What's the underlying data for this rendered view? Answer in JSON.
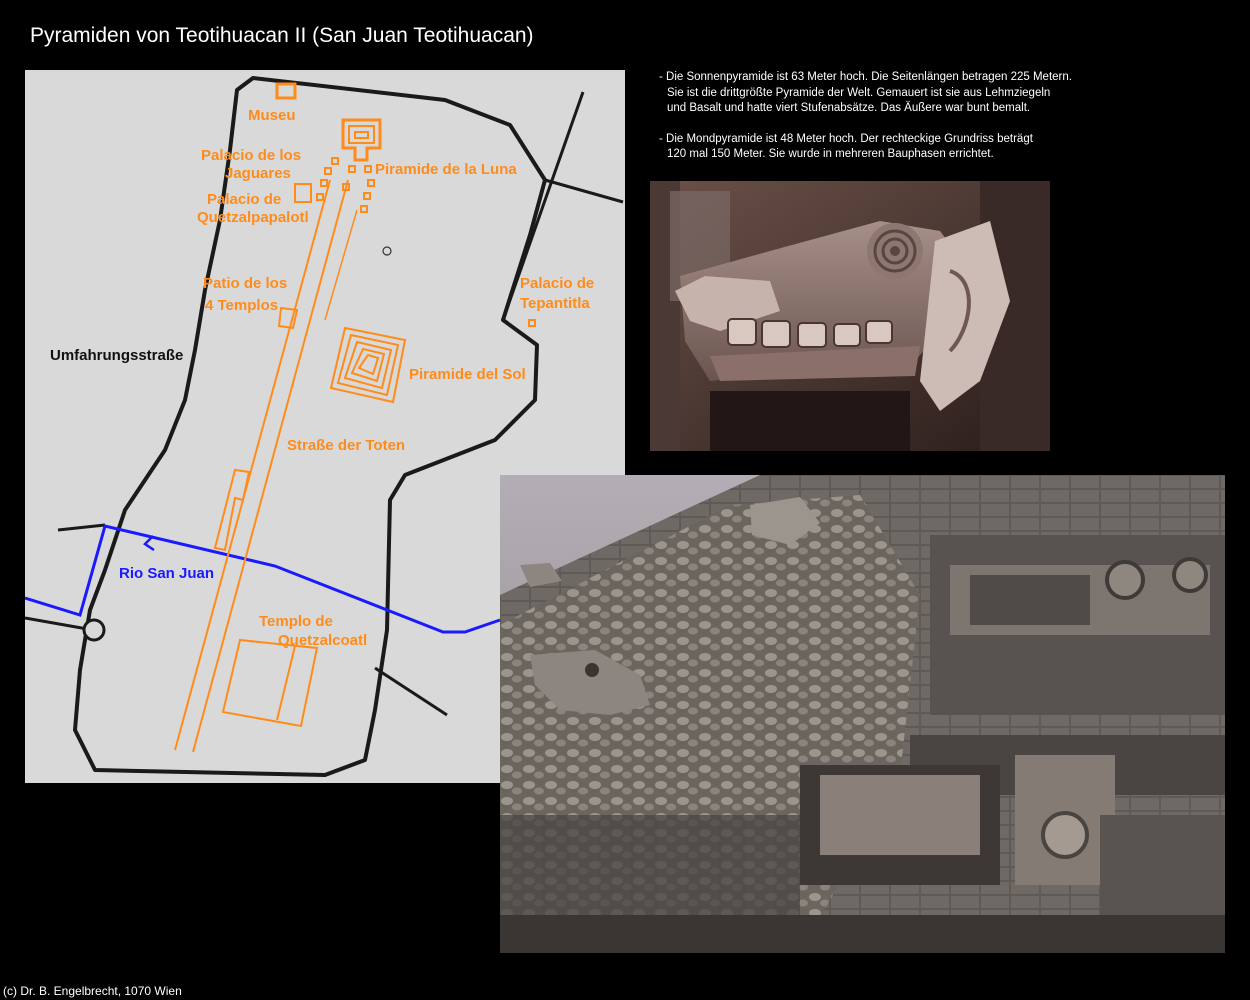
{
  "header": {
    "title": "Pyramiden von Teotihuacan II (San Juan Teotihuacan)"
  },
  "map": {
    "labels": {
      "museu": "Museu",
      "palacio_jaguares_1": "Palacio de los",
      "palacio_jaguares_2": "Jaguares",
      "piramide_luna": "Piramide de la Luna",
      "palacio_quetzal_1": "Palacio de",
      "palacio_quetzal_2": "Quetzalpapalotl",
      "patio_1": "Patio de los",
      "patio_2": "4 Templos",
      "palacio_tepantitla_1": "Palacio de",
      "palacio_tepantitla_2": "Tepantitla",
      "umfahrung": "Umfahrungsstraße",
      "piramide_sol": "Piramide del Sol",
      "strasse_toten": "Straße der Toten",
      "rio": "Rio San Juan",
      "templo_1": "Templo de",
      "templo_2": "Quetzalcoatl"
    },
    "colors": {
      "monuments": "#ff8c1a",
      "river": "#1a1aff",
      "roads": "#1a1a1a",
      "background": "#d9d9d9"
    }
  },
  "notes": {
    "note1_line1": "- Die Sonnenpyramide ist 63 Meter hoch. Die Seitenlängen betragen 225 Metern.",
    "note1_line2": "Sie ist die drittgrößte Pyramide der Welt. Gemauert ist sie aus Lehmziegeln",
    "note1_line3": "und Basalt und hatte viert Stufenabsätze. Das Äußere war bunt bemalt.",
    "note2_line1": "- Die Mondpyramide ist 48 Meter hoch. Der rechteckige Grundriss beträgt",
    "note2_line2": "120 mal 150 Meter. Sie wurde in mehreren Bauphasen errichtet."
  },
  "footer": {
    "copyright": "(c) Dr. B. Engelbrecht, 1070 Wien"
  }
}
